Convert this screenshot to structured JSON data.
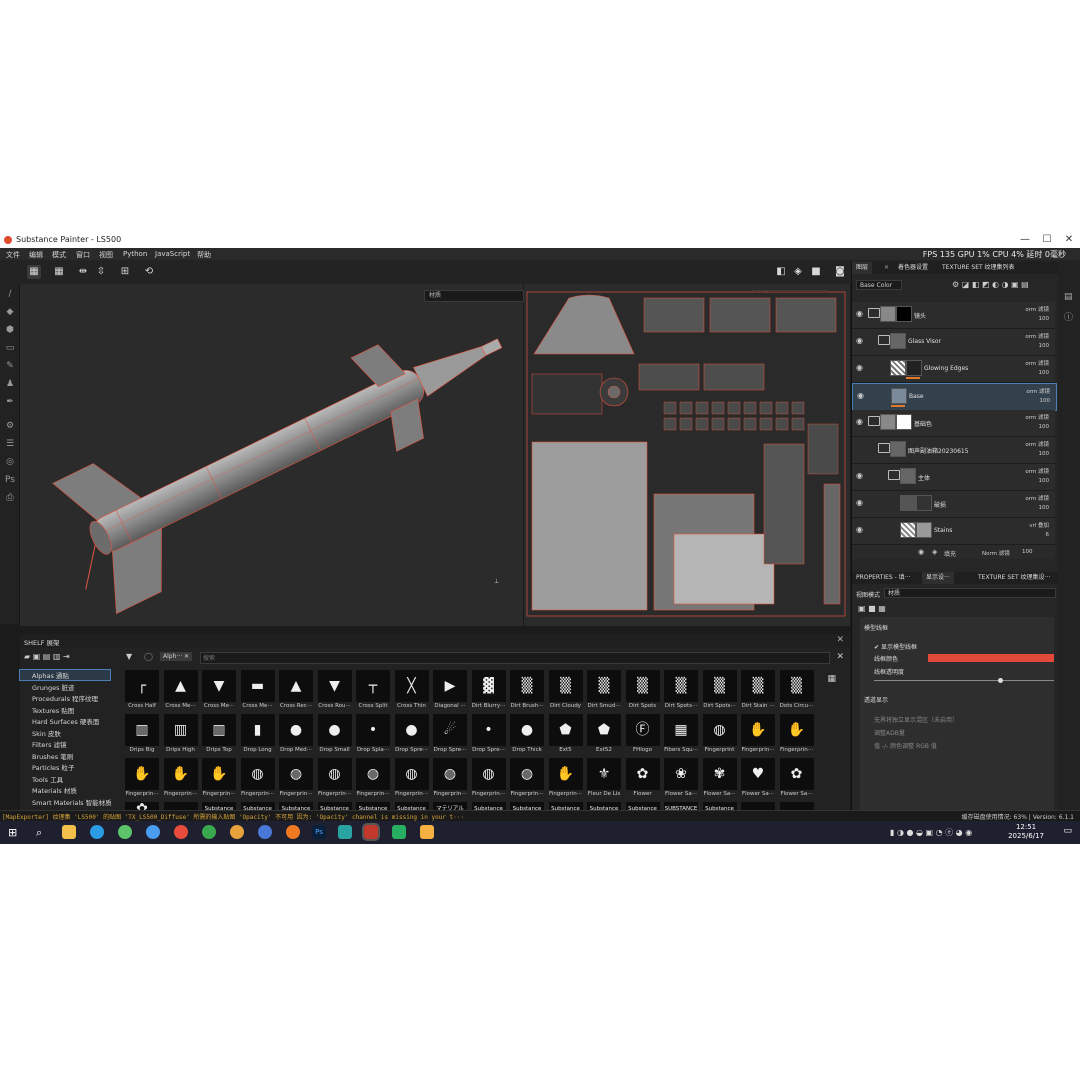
{
  "window": {
    "title": "Substance Painter - LS500",
    "controls": [
      "—",
      "☐",
      "✕"
    ]
  },
  "menu": [
    "文件",
    "编辑",
    "模式",
    "窗口",
    "视图",
    "Python",
    "JavaScript",
    "帮助"
  ],
  "perf": "FPS 135 GPU 1% CPU 4% 延时 0毫秒",
  "viewport3d": {
    "channel_select": "材质"
  },
  "viewport2d": {
    "channel_select": "材质"
  },
  "layers_panel": {
    "tabs": [
      "图层",
      "着色器设置",
      "TEXTURE SET 纹理集列表"
    ],
    "channel": "Base Color",
    "layers": [
      {
        "name": "镜头",
        "blend": "orm 滤镜",
        "opacity": "100"
      },
      {
        "name": "Glass Visor",
        "blend": "orm 滤镜",
        "opacity": "100"
      },
      {
        "name": "Glowing Edges",
        "blend": "orm 滤镜",
        "opacity": "100"
      },
      {
        "name": "Base",
        "blend": "orm 滤镜",
        "opacity": "100"
      },
      {
        "name": "基础色",
        "blend": "orm 滤镜",
        "opacity": "100"
      },
      {
        "name": "图声副油箱20230615",
        "blend": "orm 滤镜",
        "opacity": "100"
      },
      {
        "name": "主体",
        "blend": "orm 滤镜",
        "opacity": "100"
      },
      {
        "name": "破损",
        "blend": "orm 滤镜",
        "opacity": "100"
      },
      {
        "name": "Stains",
        "blend": "vrl 叠加",
        "opacity": "6"
      }
    ],
    "sub_effect": {
      "name": "填充",
      "blend": "Norm 滤镜",
      "opacity": "100"
    }
  },
  "properties_panel": {
    "tabs": [
      "PROPERTIES - 填···",
      "显示设···",
      "TEXTURE SET 纹理集设···"
    ],
    "mode_label": "视图模式",
    "mode_value": "材质",
    "section_wire": "模型线框",
    "show_wire": "显示模型线框",
    "wire_color": "线框颜色",
    "wire_opacity": "线框透明度",
    "wire_color_hex": "#e2493a",
    "wire_opacity_value": 0.7,
    "section_display": "透道显示",
    "opt1": "无界将独立显示混区（未启用）",
    "opt2": "调整ADB量",
    "opt3": "值 -/- 颜色调整 RGB 值"
  },
  "shelf": {
    "title": "SHELF 展架",
    "search_tag": "Alph···",
    "search_placeholder": "搜索",
    "categories": [
      "Alphas 通贴",
      "Grunges 脏迹",
      "Procedurals 程序纹理",
      "Textures 贴图",
      "Hard Surfaces 硬表面",
      "Skin 皮肤",
      "Filters 滤镜",
      "Brushes 笔刷",
      "Particles 粒子",
      "Tools 工具",
      "Materials 材质",
      "Smart Materials 智能材质"
    ],
    "rows": [
      [
        "Cross Half",
        "Cross Me···",
        "Cross Me···",
        "Cross Me···",
        "Cross Rec···",
        "Cross Rou···",
        "Cross Split",
        "Cross Thin",
        "Diagonal ···",
        "Dirt Blurry···",
        "Dirt Brush···",
        "Dirt Cloudy",
        "Dirt Smud···",
        "Dirt Spots",
        "Dirt Spots···",
        "Dirt Spots···",
        "Dirt Stain ···",
        "Dots Circu···"
      ],
      [
        "Drips Big",
        "Drips High",
        "Drips Top",
        "Drop Long",
        "Drop Med···",
        "Drop Small",
        "Drop Spla···",
        "Drop Spre···",
        "Drop Spre···",
        "Drop Spre···",
        "Drop Thick",
        "Ext5",
        "Ext52",
        "FHlogo",
        "Fibers Squ···",
        "Fingerprint",
        "Fingerprin···",
        "Fingerprin···"
      ],
      [
        "Fingerprin···",
        "Fingerprin···",
        "Fingerprin···",
        "Fingerprin···",
        "Fingerprin···",
        "Fingerprin···",
        "Fingerprin···",
        "Fingerprin···",
        "Fingerprin···",
        "Fingerprin···",
        "Fingerprin···",
        "Fingerprin···",
        "Fleur De Lis",
        "Flower",
        "Flower Sa···",
        "Flower Sa···",
        "Flower Sa···",
        "Flower Sa···"
      ]
    ],
    "row4": [
      "",
      "",
      "Substance",
      "Substance",
      "Substance",
      "Substance",
      "Substance",
      "Substance",
      "マテリアル 材質",
      "Substance",
      "Substance",
      "Substance",
      "Substance",
      "Substance",
      "SUBSTANCE",
      "Substance",
      "",
      ""
    ]
  },
  "status": {
    "log": "[MapExporter] 纹理集 'LS500' 的贴图 'TX_LS500_Diffuse' 所需的输入贴图 'Opacity' 不可用 因为: 'Opacity' channel is missing in your t···",
    "right": "缓存磁盘使用情况: 63% | Version: 6.1.1"
  },
  "taskbar": {
    "time": "12:51",
    "date": "2025/6/17"
  }
}
